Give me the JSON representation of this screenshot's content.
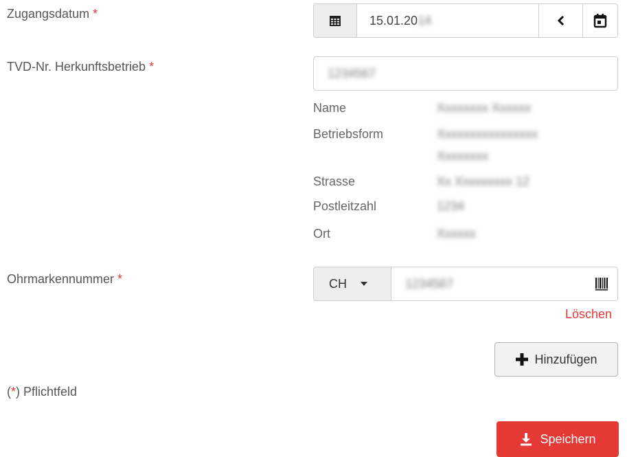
{
  "form": {
    "zugangsdatum_label": "Zugangsdatum",
    "required_mark": "*",
    "zugangsdatum_value": "15.01.20",
    "zugangsdatum_value_blur": "14",
    "tvd_label": "TVD-Nr. Herkunftsbetrieb",
    "tvd_value": "1234567",
    "info": {
      "name_label": "Name",
      "name_value": "Xxxxxxxx Xxxxxx",
      "betriebsform_label": "Betriebsform",
      "betriebsform_value_1": "Xxxxxxxxxxxxxxxx",
      "betriebsform_value_2": "Xxxxxxxx",
      "strasse_label": "Strasse",
      "strasse_value": "Xx Xxxxxxxxx 12",
      "plz_label": "Postleitzahl",
      "plz_value": "1234",
      "ort_label": "Ort",
      "ort_value": "Xxxxxx"
    },
    "ohrmarke_label": "Ohrmarkennummer",
    "ohrmarke_country": "CH",
    "ohrmarke_value": "1234567",
    "delete_label": "Löschen",
    "add_label": "Hinzufügen",
    "pflicht_open": "(",
    "pflicht_mark": "*",
    "pflicht_rest": ") Pflichtfeld",
    "save_label": "Speichern"
  },
  "colors": {
    "accent_red": "#e53935",
    "addon_bg": "#eeeeee",
    "border": "#cfcfcf"
  },
  "icons": [
    "calendar-icon",
    "chevron-left-icon",
    "calendar-event-icon",
    "caret-down-icon",
    "barcode-icon",
    "plus-icon",
    "download-icon"
  ]
}
